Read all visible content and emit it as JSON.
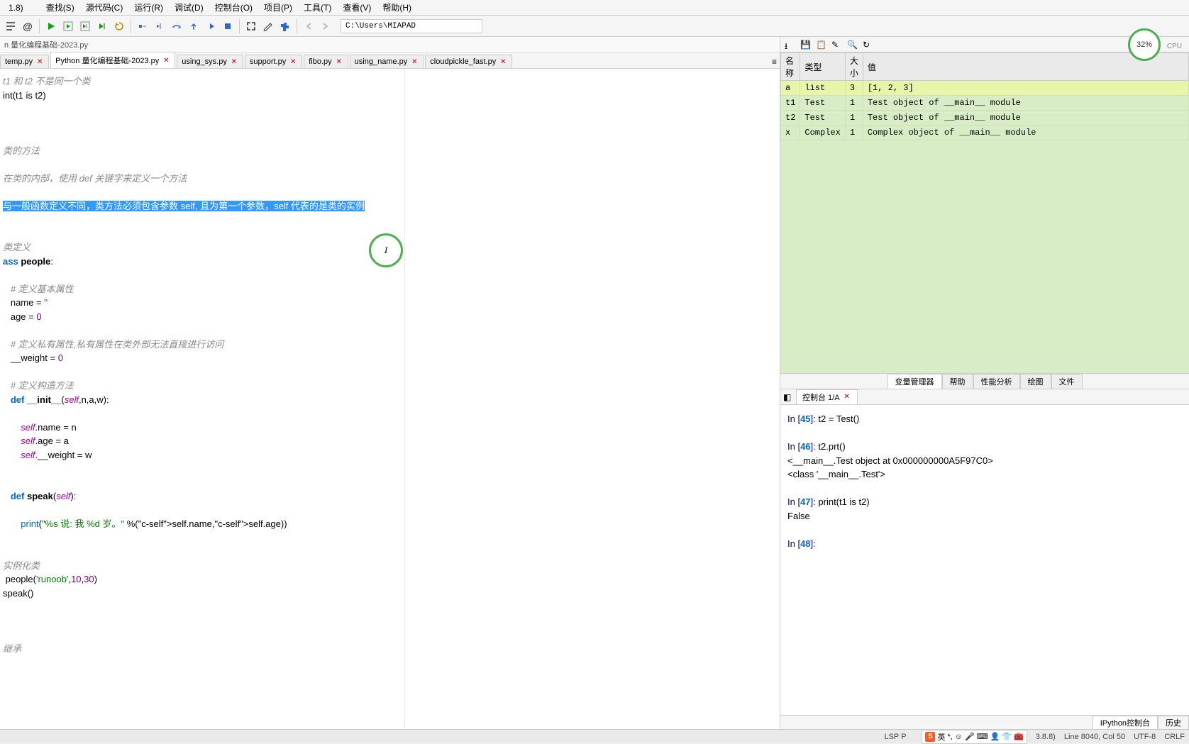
{
  "title_fragment": "1.8)",
  "menu": {
    "items": [
      "查找(S)",
      "源代码(C)",
      "运行(R)",
      "调试(D)",
      "控制台(O)",
      "项目(P)",
      "工具(T)",
      "查看(V)",
      "帮助(H)"
    ]
  },
  "toolbar": {
    "path": "C:\\Users\\MIAPAD"
  },
  "cpu": {
    "percent": "32%",
    "label": "CPU"
  },
  "breadcrumb": "n 量化编程基础-2023.py",
  "tabs": [
    {
      "label": "temp.py",
      "active": false
    },
    {
      "label": "Python 量化编程基础-2023.py",
      "active": true
    },
    {
      "label": "using_sys.py",
      "active": false
    },
    {
      "label": "support.py",
      "active": false
    },
    {
      "label": "fibo.py",
      "active": false
    },
    {
      "label": "using_name.py",
      "active": false
    },
    {
      "label": "cloudpickle_fast.py",
      "active": false
    }
  ],
  "editor": {
    "lines": [
      {
        "type": "comment",
        "text": "t1 和 t2 不是同一个类"
      },
      {
        "type": "code",
        "text": "int(t1 is t2)"
      },
      {
        "type": "blank"
      },
      {
        "type": "blank"
      },
      {
        "type": "blank"
      },
      {
        "type": "comment",
        "text": "类的方法"
      },
      {
        "type": "blank"
      },
      {
        "type": "comment",
        "text": "在类的内部，使用 def 关键字来定义一个方法"
      },
      {
        "type": "blank"
      },
      {
        "type": "comment_sel",
        "text": "与一般函数定义不同，类方法必须包含参数 self, 且为第一个参数，self 代表的是类的实例"
      },
      {
        "type": "blank"
      },
      {
        "type": "blank"
      },
      {
        "type": "comment",
        "text": "类定义"
      },
      {
        "type": "class",
        "text": "ass people:"
      },
      {
        "type": "blank"
      },
      {
        "type": "comment_i",
        "text": "   # 定义基本属性"
      },
      {
        "type": "assign",
        "text": "   name = ''"
      },
      {
        "type": "assign",
        "text": "   age = 0"
      },
      {
        "type": "blank"
      },
      {
        "type": "comment_i",
        "text": "   # 定义私有属性,私有属性在类外部无法直接进行访问"
      },
      {
        "type": "assign",
        "text": "   __weight = 0"
      },
      {
        "type": "blank"
      },
      {
        "type": "comment_i",
        "text": "   # 定义构造方法"
      },
      {
        "type": "def",
        "name": "__init__",
        "args": "(self,n,a,w):"
      },
      {
        "type": "blank"
      },
      {
        "type": "self_assign",
        "text": "       self.name = n"
      },
      {
        "type": "self_assign",
        "text": "       self.age = a"
      },
      {
        "type": "self_assign",
        "text": "       self.__weight = w"
      },
      {
        "type": "blank"
      },
      {
        "type": "blank"
      },
      {
        "type": "def",
        "name": "speak",
        "args": "(self):"
      },
      {
        "type": "blank"
      },
      {
        "type": "print",
        "text": "       print(\"%s 说: 我 %d 岁。\" %(self.name,self.age))"
      },
      {
        "type": "blank"
      },
      {
        "type": "blank"
      },
      {
        "type": "comment",
        "text": "实例化类"
      },
      {
        "type": "code2",
        "text": " people('runoob',10,30)"
      },
      {
        "type": "code",
        "text": "speak()"
      },
      {
        "type": "blank"
      },
      {
        "type": "blank"
      },
      {
        "type": "blank"
      },
      {
        "type": "comment",
        "text": "继承"
      }
    ]
  },
  "var_table": {
    "headers": [
      "名称",
      "类型",
      "大小",
      "值"
    ],
    "rows": [
      {
        "name": "a",
        "type": "list",
        "size": "3",
        "value": "[1, 2, 3]",
        "hl": true
      },
      {
        "name": "t1",
        "type": "Test",
        "size": "1",
        "value": "Test object of __main__ module"
      },
      {
        "name": "t2",
        "type": "Test",
        "size": "1",
        "value": "Test object of __main__ module"
      },
      {
        "name": "x",
        "type": "Complex",
        "size": "1",
        "value": "Complex object of __main__ module"
      }
    ]
  },
  "right_bottom_tabs": [
    "变量管理器",
    "帮助",
    "性能分析",
    "绘图",
    "文件"
  ],
  "console_tab_label": "控制台 1/A",
  "console": [
    {
      "prompt": "In [45]:",
      "code": " t2 = Test()"
    },
    {
      "blank": true
    },
    {
      "prompt": "In [46]:",
      "code": " t2.prt()"
    },
    {
      "out": "<__main__.Test object at 0x000000000A5F97C0>"
    },
    {
      "out": "<class '__main__.Test'>"
    },
    {
      "blank": true
    },
    {
      "prompt": "In [47]:",
      "code": " print(t1 is t2)"
    },
    {
      "out": "False"
    },
    {
      "blank": true
    },
    {
      "prompt": "In [48]:",
      "code": " "
    }
  ],
  "console_bottom_tabs": [
    "IPython控制台",
    "历史"
  ],
  "status": {
    "lsp": "LSP P",
    "ime_letter": "S",
    "ime_han": "英",
    "pyver": "3.8.8)",
    "line_col": "Line 8040, Col 50",
    "encoding": "UTF-8",
    "eol": "CRLF"
  }
}
